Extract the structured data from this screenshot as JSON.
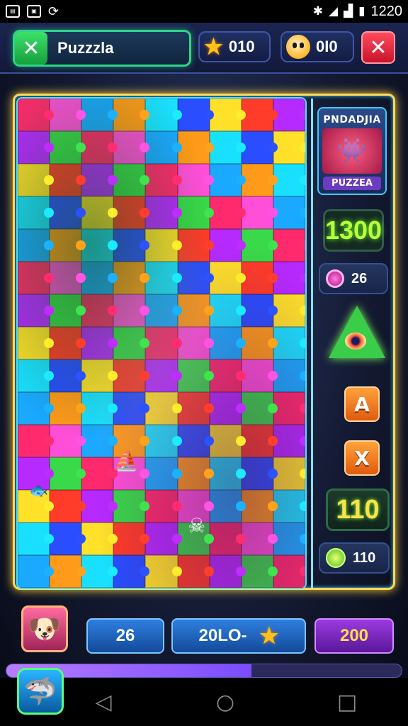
{
  "status_bar": {
    "time": "1220",
    "left_icons": [
      "notification-icon",
      "photo-icon",
      "sync-icon"
    ],
    "right_icons": [
      "bluetooth-icon",
      "wifi-icon",
      "signal-icon",
      "battery-icon"
    ]
  },
  "header": {
    "title": "Puzzzla",
    "stars": "010",
    "coins": "0I0"
  },
  "sidebar": {
    "preview_title": "PNDADJIA",
    "preview_label": "PUZZEA",
    "timer": "1300",
    "hints": "26",
    "btn_a": "A",
    "btn_x": "X",
    "score": "110",
    "bonus": "110"
  },
  "bottom": {
    "moves": "26",
    "points": "20LO-­",
    "total": "200",
    "progress": 0.62
  },
  "colors": {
    "accent": "#2fd48a",
    "board_border": "#ffd95a",
    "close": "#e0263a",
    "timer_text": "#b8ff3a"
  },
  "puzzle_palette": [
    "#ff2a6d",
    "#ff9a1a",
    "#ffe12a",
    "#3ad94a",
    "#1aa9ff",
    "#2a4dff",
    "#b62aff",
    "#ff4fd8",
    "#1ae0ff",
    "#ff3b2a"
  ]
}
